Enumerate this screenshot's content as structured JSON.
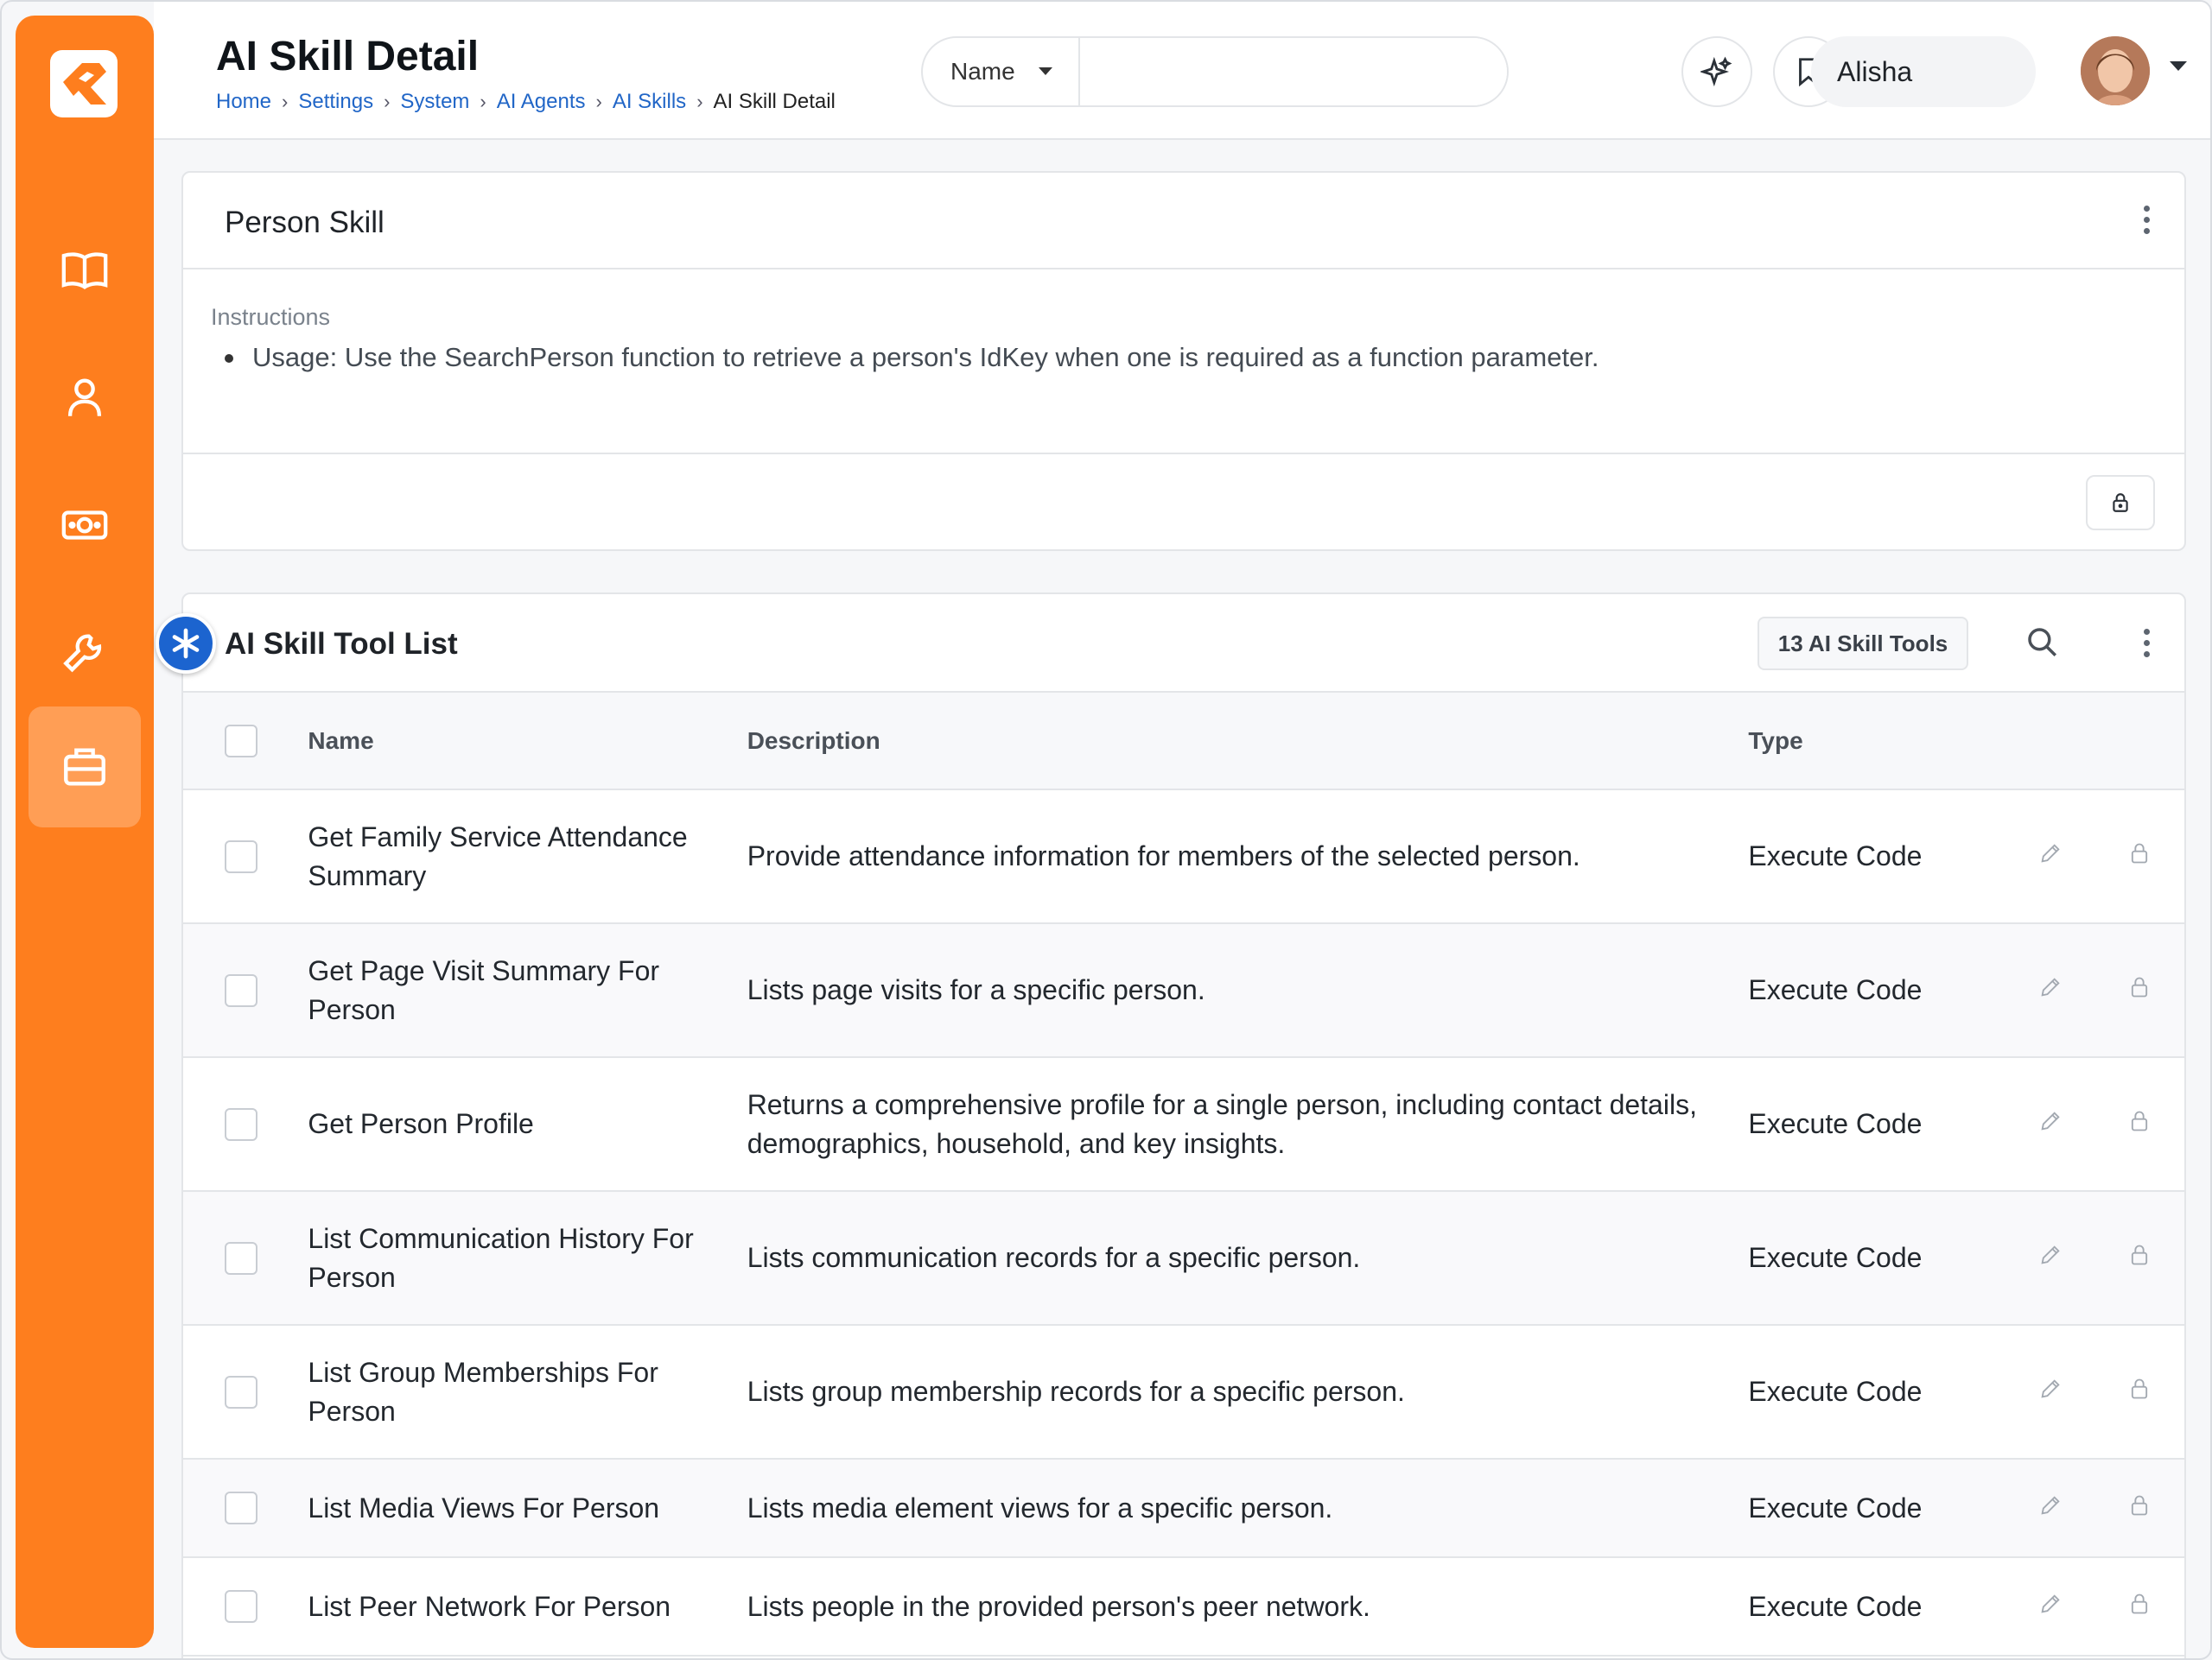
{
  "header": {
    "title": "AI Skill Detail",
    "breadcrumb": [
      "Home",
      "Settings",
      "System",
      "AI Agents",
      "AI Skills"
    ],
    "breadcrumb_current": "AI Skill Detail",
    "search": {
      "field_label": "Name",
      "placeholder": ""
    },
    "user": {
      "name": "Alisha"
    }
  },
  "sidebar": {
    "items": [
      {
        "icon": "book-icon"
      },
      {
        "icon": "person-icon"
      },
      {
        "icon": "money-icon"
      },
      {
        "icon": "wrench-icon"
      },
      {
        "icon": "briefcase-icon",
        "active": true
      }
    ]
  },
  "skill": {
    "title": "Person Skill",
    "instructions_label": "Instructions",
    "instructions": [
      "Usage: Use the SearchPerson function to retrieve a person's IdKey when one is required as a function parameter."
    ]
  },
  "tools": {
    "title": "AI Skill Tool List",
    "count_label": "13 AI Skill Tools",
    "columns": {
      "name": "Name",
      "description": "Description",
      "type": "Type"
    },
    "rows": [
      {
        "name": "Get Family Service Attendance Summary",
        "description": "Provide attendance information for members of the selected person.",
        "type": "Execute Code"
      },
      {
        "name": "Get Page Visit Summary For Person",
        "description": "Lists page visits for a specific person.",
        "type": "Execute Code"
      },
      {
        "name": "Get Person Profile",
        "description": "Returns a comprehensive profile for a single person, including contact details, demographics, household, and key insights.",
        "type": "Execute Code"
      },
      {
        "name": "List Communication History For Person",
        "description": "Lists communication records for a specific person.",
        "type": "Execute Code"
      },
      {
        "name": "List Group Memberships For Person",
        "description": "Lists group membership records for a specific person.",
        "type": "Execute Code"
      },
      {
        "name": "List Media Views For Person",
        "description": "Lists media element views for a specific person.",
        "type": "Execute Code"
      },
      {
        "name": "List Peer Network For Person",
        "description": "Lists people in the provided person's peer network.",
        "type": "Execute Code"
      }
    ]
  },
  "colors": {
    "brand": "#fe7e1e",
    "link": "#2166c7",
    "accent": "#1c64cf"
  }
}
